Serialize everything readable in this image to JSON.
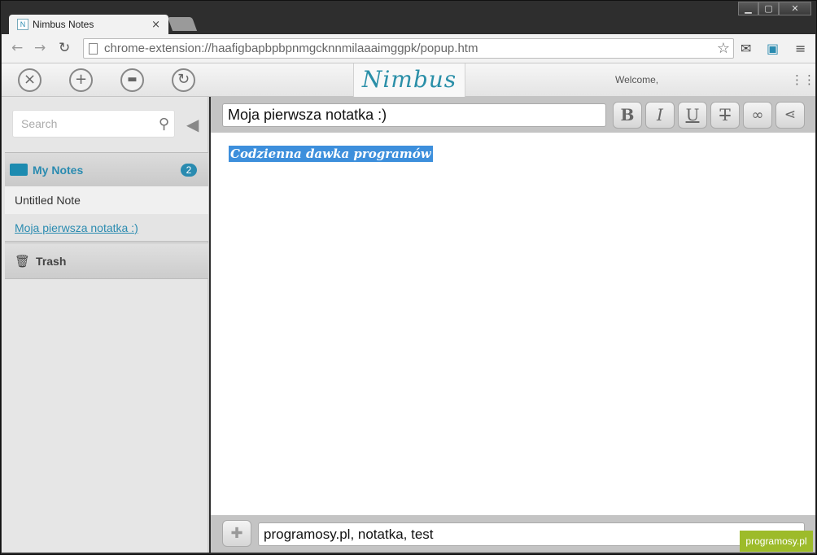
{
  "browser": {
    "tab_title": "Nimbus Notes",
    "tab_close": "×",
    "url": "chrome-extension://haafigbapbpbpnmgcknnmilaaaimggpk/popup.htm",
    "win_min": "▁",
    "win_max": "▢",
    "win_close": "✕"
  },
  "header": {
    "logo": "Nimbus",
    "welcome": "Welcome,"
  },
  "sidebar": {
    "search_placeholder": "Search",
    "folder_label": "My Notes",
    "folder_count": "2",
    "notes": [
      "Untitled Note",
      "Moja pierwsza notatka :)"
    ],
    "trash_label": "Trash"
  },
  "editor": {
    "title": "Moja pierwsza notatka :)",
    "bold": "B",
    "italic": "I",
    "underline": "U",
    "strike": "T",
    "content": "Codzienna dawka programów",
    "tags": "programosy.pl, notatka, test"
  },
  "watermark": "programosy.pl",
  "colors": {
    "accent": "#2a8bb0",
    "selection": "#3d8fdc",
    "watermark": "#9dbb2a"
  }
}
